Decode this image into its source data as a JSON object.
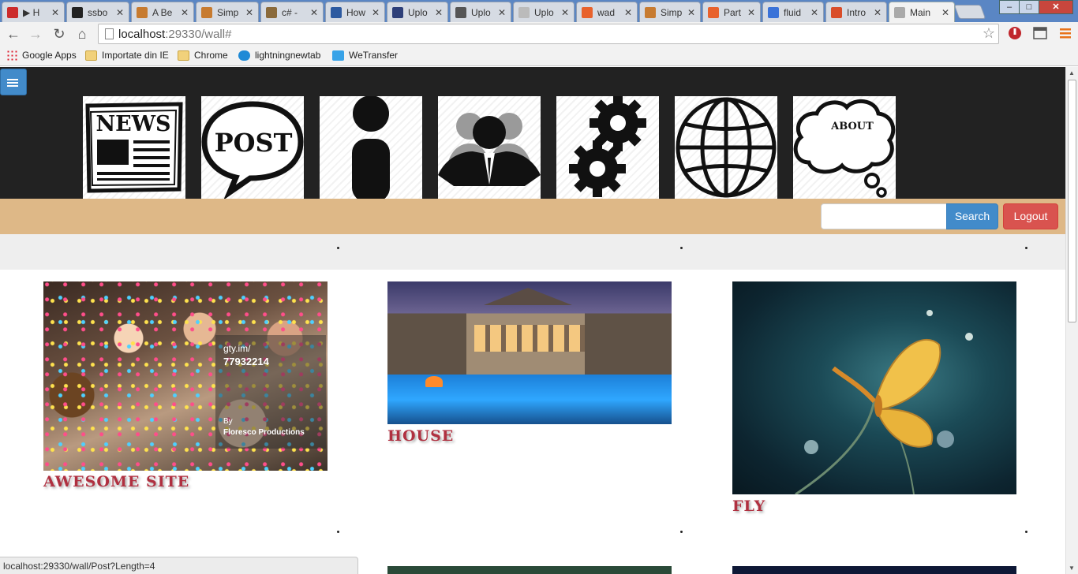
{
  "browser": {
    "tabs": [
      {
        "label": "▶ H",
        "color": "#cc2b2b"
      },
      {
        "label": "ssbo",
        "color": "#222222"
      },
      {
        "label": "A Be",
        "color": "#c77b30"
      },
      {
        "label": "Simp",
        "color": "#c77b30"
      },
      {
        "label": "c# -",
        "color": "#8a6a3b"
      },
      {
        "label": "How",
        "color": "#2d5aa0"
      },
      {
        "label": "Uplo",
        "color": "#2d3f79"
      },
      {
        "label": "Uplo",
        "color": "#555555"
      },
      {
        "label": "Uplo",
        "color": "#bbbbbb"
      },
      {
        "label": "wad",
        "color": "#e8622c"
      },
      {
        "label": "Simp",
        "color": "#c77b30"
      },
      {
        "label": "Part",
        "color": "#e8622c"
      },
      {
        "label": "fluid",
        "color": "#3b73d8"
      },
      {
        "label": "Intro",
        "color": "#d94d2a"
      },
      {
        "label": "Main",
        "color": "#aaaaaa"
      }
    ],
    "url_host": "localhost",
    "url_rest": ":29330/wall#",
    "bookmarks": [
      {
        "label": "Google Apps",
        "icon": "apps-grid-icon"
      },
      {
        "label": "Importate din IE",
        "icon": "folder-icon"
      },
      {
        "label": "Chrome",
        "icon": "folder-icon"
      },
      {
        "label": "lightningnewtab",
        "icon": "lightning-icon"
      },
      {
        "label": "WeTransfer",
        "icon": "wetransfer-icon"
      }
    ],
    "status_url": "localhost:29330/wall/Post?Length=4"
  },
  "header": {
    "nav_icons": [
      {
        "name": "news",
        "label": "NEWS"
      },
      {
        "name": "post",
        "label": "POST"
      },
      {
        "name": "person",
        "label": ""
      },
      {
        "name": "group",
        "label": ""
      },
      {
        "name": "settings",
        "label": ""
      },
      {
        "name": "globe",
        "label": ""
      },
      {
        "name": "about",
        "label": "ABOUT"
      }
    ],
    "search_button": "Search",
    "logout_button": "Logout",
    "search_placeholder": ""
  },
  "posts": [
    {
      "title": "AWESOME SITE",
      "watermark_site": "gty.im/",
      "watermark_id": "77932214",
      "watermark_by": "By",
      "watermark_credit": "Floresco Productions"
    },
    {
      "title": "HOUSE"
    },
    {
      "title": "FLY"
    }
  ],
  "colors": {
    "header_bg": "#222222",
    "nav_strip": "#deb887",
    "search_button": "#428bca",
    "logout_button": "#d9534f",
    "post_title": "#b03040"
  }
}
